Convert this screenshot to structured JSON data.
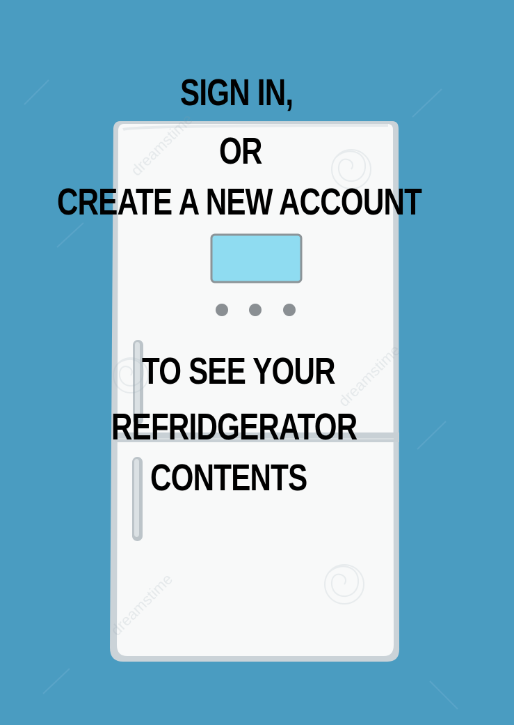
{
  "message": {
    "line_1": "SIGN IN,",
    "line_2": "OR",
    "line_3": "CREATE A NEW ACCOUNT",
    "line_4": "TO SEE YOUR",
    "line_5": "REFRIDGERATOR",
    "line_6": "CONTENTS"
  },
  "watermark": {
    "text": "dreamstime"
  },
  "colors": {
    "background": "#4a9cc1",
    "fridge_body": "#f7f8f8",
    "fridge_outline": "#c9d1d6",
    "display": "#8fdcf1",
    "buttons": "#8a8f93",
    "text": "#000000"
  },
  "icons": {
    "appliance": "refrigerator-icon",
    "display": "display-panel-icon",
    "controls": "control-dot-icon",
    "handle": "handle-icon"
  }
}
